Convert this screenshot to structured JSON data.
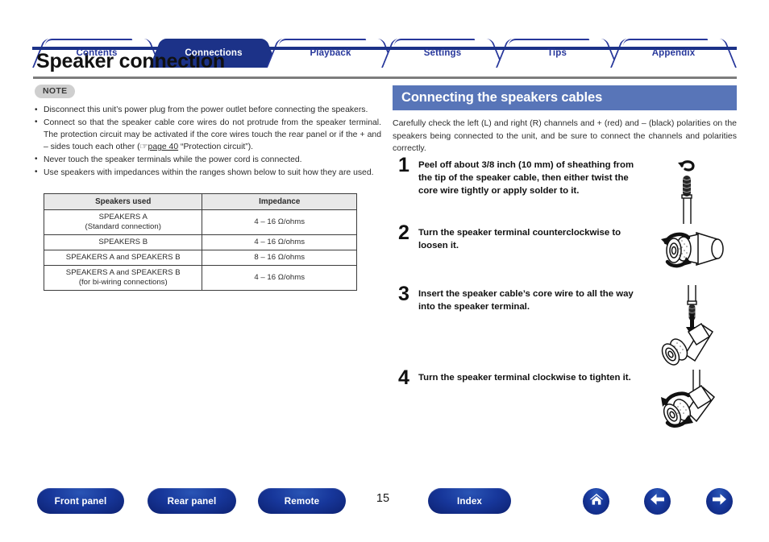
{
  "tabs": [
    {
      "label": "Contents",
      "active": false
    },
    {
      "label": "Connections",
      "active": true
    },
    {
      "label": "Playback",
      "active": false
    },
    {
      "label": "Settings",
      "active": false
    },
    {
      "label": "Tips",
      "active": false
    },
    {
      "label": "Appendix",
      "active": false
    }
  ],
  "page_title": "Speaker connection",
  "note": {
    "badge": "NOTE",
    "bullets": [
      "Disconnect this unit’s power plug from the power outlet before connecting the speakers.",
      "Connect so that the speaker cable core wires do not protrude from the speaker terminal. The protection circuit may be activated if the core wires touch the rear panel or if the + and – sides touch each other (",
      "Never touch the speaker terminals while the power cord is connected.",
      "Use speakers with impedances within the ranges shown below to suit how they are used."
    ],
    "link_prefix": "(",
    "link_text": "page 40",
    "link_suffix": " “Protection circuit”).",
    "hand_icon": "☞"
  },
  "table": {
    "headers": [
      "Speakers used",
      "Impedance"
    ],
    "rows": [
      {
        "speakers_line1": "SPEAKERS A",
        "speakers_line2": "(Standard connection)",
        "impedance": "4 – 16 Ω/ohms"
      },
      {
        "speakers_line1": "SPEAKERS B",
        "speakers_line2": "",
        "impedance": "4 – 16 Ω/ohms"
      },
      {
        "speakers_line1": "SPEAKERS A and SPEAKERS B",
        "speakers_line2": "",
        "impedance": "8 – 16 Ω/ohms"
      },
      {
        "speakers_line1": "SPEAKERS A and SPEAKERS B",
        "speakers_line2": "(for bi-wiring connections)",
        "impedance": "4 – 16 Ω/ohms"
      }
    ]
  },
  "section": {
    "heading": "Connecting the speakers cables",
    "intro": "Carefully check the left (L) and right (R) channels and + (red) and – (black) polarities on the speakers being connected to the unit, and be sure to connect the channels and polarities correctly."
  },
  "steps": [
    {
      "number": "1",
      "text": "Peel off about 3/8 inch (10 mm) of sheathing from the tip of the speaker cable, then either twist the core wire tightly or apply solder to it.",
      "art": "twisted-wire-tip-illustration"
    },
    {
      "number": "2",
      "text": "Turn the speaker terminal counterclockwise to loosen it.",
      "art": "terminal-counterclockwise-illustration"
    },
    {
      "number": "3",
      "text": "Insert the speaker cable’s core wire to all the way into the speaker terminal.",
      "art": "insert-wire-illustration"
    },
    {
      "number": "4",
      "text": "Turn the speaker terminal clockwise to tighten it.",
      "art": "terminal-clockwise-illustration"
    }
  ],
  "footer": {
    "buttons": [
      {
        "label": "Front panel"
      },
      {
        "label": "Rear panel"
      },
      {
        "label": "Remote"
      },
      {
        "label": "Index"
      }
    ],
    "page_number": "15",
    "icons": [
      {
        "name": "home-icon"
      },
      {
        "name": "arrow-left-icon"
      },
      {
        "name": "arrow-right-icon"
      }
    ]
  },
  "colors": {
    "tab_active_bg": "#1c3288",
    "tab_text": "#27379b",
    "section_bar_bg": "#5875b8",
    "note_badge_bg": "#cfcfcf",
    "footer_button_bg": "#17379b",
    "title_rule": "#7d7d7d"
  }
}
